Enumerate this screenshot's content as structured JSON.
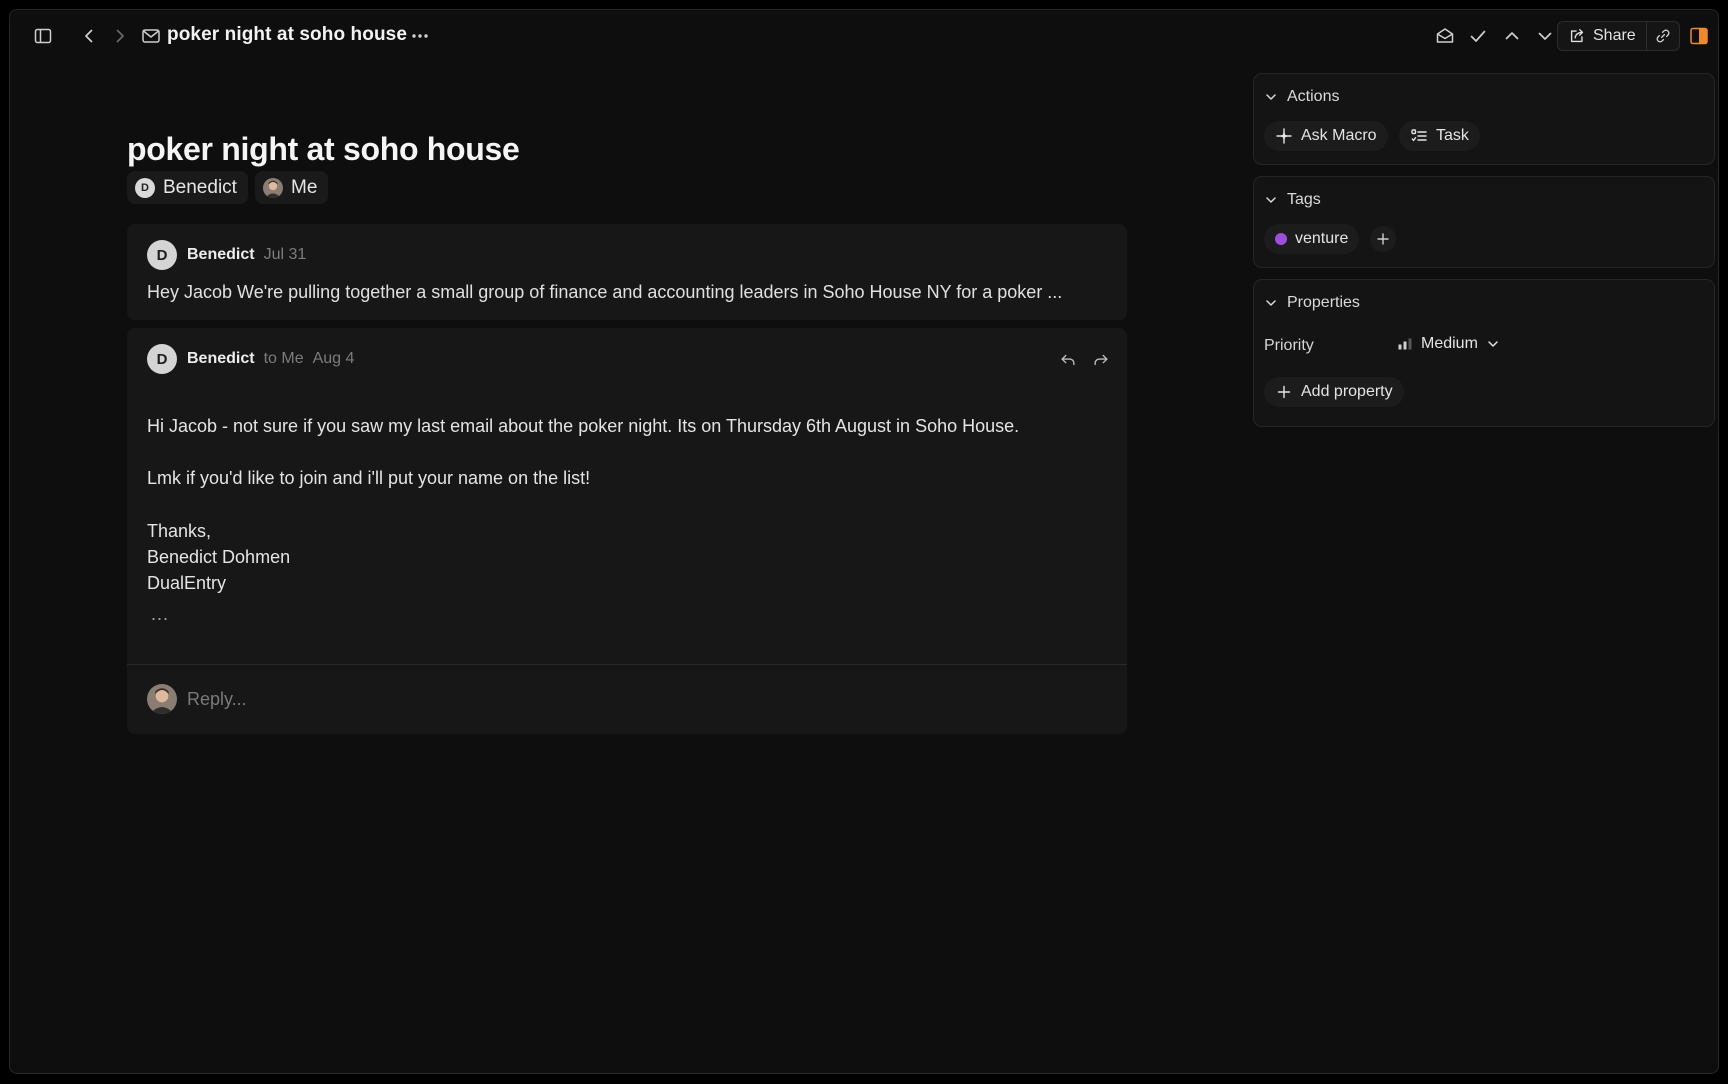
{
  "toolbar": {
    "title": "poker night at soho house",
    "share_label": "Share",
    "accent": "#f08a24"
  },
  "thread": {
    "title": "poker night at soho house",
    "participants": [
      {
        "name": "Benedict",
        "initial": "D"
      },
      {
        "name": "Me"
      }
    ]
  },
  "messages": [
    {
      "initial": "D",
      "sender": "Benedict",
      "date": "Jul 31",
      "preview": "Hey Jacob We're pulling together a small group of finance and accounting leaders in Soho House NY for a poker ..."
    },
    {
      "initial": "D",
      "sender": "Benedict",
      "recipient": "to Me",
      "date": "Aug 4",
      "body": [
        "Hi Jacob - not sure if you saw my last email about the poker night. Its on Thursday 6th August in Soho House.",
        "Lmk if you'd like to join and i'll put your name on the list!",
        "Thanks,",
        "Benedict Dohmen",
        "DualEntry"
      ],
      "more": "..."
    }
  ],
  "reply": {
    "placeholder": "Reply..."
  },
  "sidebar": {
    "actions": {
      "heading": "Actions",
      "ask_macro": "Ask Macro",
      "task": "Task"
    },
    "tags": {
      "heading": "Tags",
      "items": [
        {
          "label": "venture",
          "color": "#9b4fdc"
        }
      ]
    },
    "properties": {
      "heading": "Properties",
      "priority_label": "Priority",
      "priority_value": "Medium",
      "add_property": "Add property"
    }
  }
}
